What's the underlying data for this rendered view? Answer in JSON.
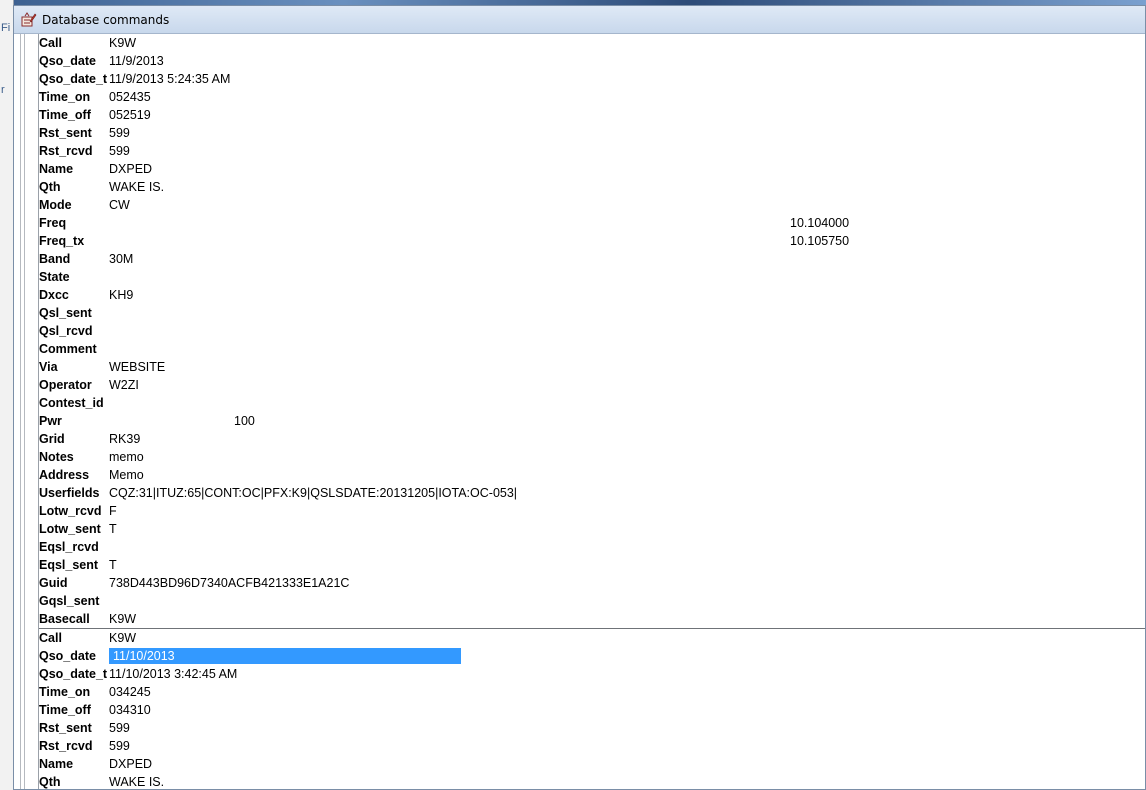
{
  "window": {
    "title": "Database commands"
  },
  "background_app": {
    "fragments": [
      "Fi",
      "r"
    ]
  },
  "records": [
    {
      "fields": [
        {
          "label": "Call",
          "value": "K9W"
        },
        {
          "label": "Qso_date",
          "value": "11/9/2013"
        },
        {
          "label": "Qso_date_t",
          "value": "11/9/2013 5:24:35 AM"
        },
        {
          "label": "Time_on",
          "value": "052435"
        },
        {
          "label": "Time_off",
          "value": "052519"
        },
        {
          "label": "Rst_sent",
          "value": "599"
        },
        {
          "label": "Rst_rcvd",
          "value": "599"
        },
        {
          "label": "Name",
          "value": "DXPED"
        },
        {
          "label": "Qth",
          "value": "WAKE IS."
        },
        {
          "label": "Mode",
          "value": "CW"
        },
        {
          "label": "Freq",
          "value": "10.104000",
          "align": "wide"
        },
        {
          "label": "Freq_tx",
          "value": "10.105750",
          "align": "wide"
        },
        {
          "label": "Band",
          "value": "30M"
        },
        {
          "label": "State",
          "value": ""
        },
        {
          "label": "Dxcc",
          "value": "KH9"
        },
        {
          "label": "Qsl_sent",
          "value": ""
        },
        {
          "label": "Qsl_rcvd",
          "value": ""
        },
        {
          "label": "Comment",
          "value": ""
        },
        {
          "label": "Via",
          "value": "WEBSITE"
        },
        {
          "label": "Operator",
          "value": "W2ZI"
        },
        {
          "label": "Contest_id",
          "value": ""
        },
        {
          "label": "Pwr",
          "value": "100",
          "align": "pwr"
        },
        {
          "label": "Grid",
          "value": "RK39"
        },
        {
          "label": "Notes",
          "value": "memo"
        },
        {
          "label": "Address",
          "value": "Memo"
        },
        {
          "label": "Userfields",
          "value": "CQZ:31|ITUZ:65|CONT:OC|PFX:K9|QSLSDATE:20131205|IOTA:OC-053|"
        },
        {
          "label": "Lotw_rcvd",
          "value": "F"
        },
        {
          "label": "Lotw_sent",
          "value": "T"
        },
        {
          "label": "Eqsl_rcvd",
          "value": ""
        },
        {
          "label": "Eqsl_sent",
          "value": "T"
        },
        {
          "label": "Guid",
          "value": "738D443BD96D7340ACFB421333E1A21C"
        },
        {
          "label": "Gqsl_sent",
          "value": ""
        },
        {
          "label": "Basecall",
          "value": "K9W"
        }
      ]
    },
    {
      "fields": [
        {
          "label": "Call",
          "value": "K9W"
        },
        {
          "label": "Qso_date",
          "value": "11/10/2013",
          "selected": true
        },
        {
          "label": "Qso_date_t",
          "value": "11/10/2013 3:42:45 AM"
        },
        {
          "label": "Time_on",
          "value": "034245"
        },
        {
          "label": "Time_off",
          "value": "034310"
        },
        {
          "label": "Rst_sent",
          "value": "599"
        },
        {
          "label": "Rst_rcvd",
          "value": "599"
        },
        {
          "label": "Name",
          "value": "DXPED"
        },
        {
          "label": "Qth",
          "value": "WAKE IS."
        }
      ]
    }
  ],
  "colors": {
    "selection": "#3399ff",
    "title_bar": "#c8d8ec"
  }
}
